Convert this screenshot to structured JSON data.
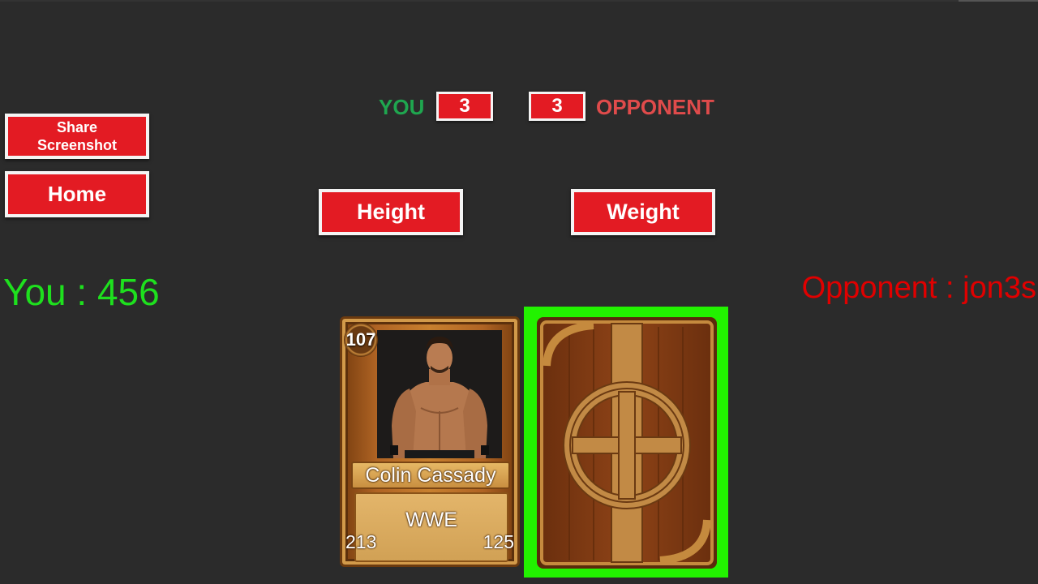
{
  "buttons": {
    "share": "Share Screenshot",
    "home": "Home",
    "height": "Height",
    "weight": "Weight"
  },
  "scoreboard": {
    "you_label": "YOU",
    "you_score": "3",
    "opponent_score": "3",
    "opponent_label": "OPPONENT"
  },
  "players": {
    "you": "You : 456",
    "opponent": "Opponent : jon3s"
  },
  "player_card": {
    "level": "107",
    "name": "Colin Cassady",
    "promotion": "WWE",
    "stat_left": "213",
    "stat_right": "125"
  },
  "colors": {
    "button_red": "#e31b23",
    "you_green": "#1ee01e",
    "opponent_red": "#e00000",
    "selected_card_border": "#22f200"
  }
}
